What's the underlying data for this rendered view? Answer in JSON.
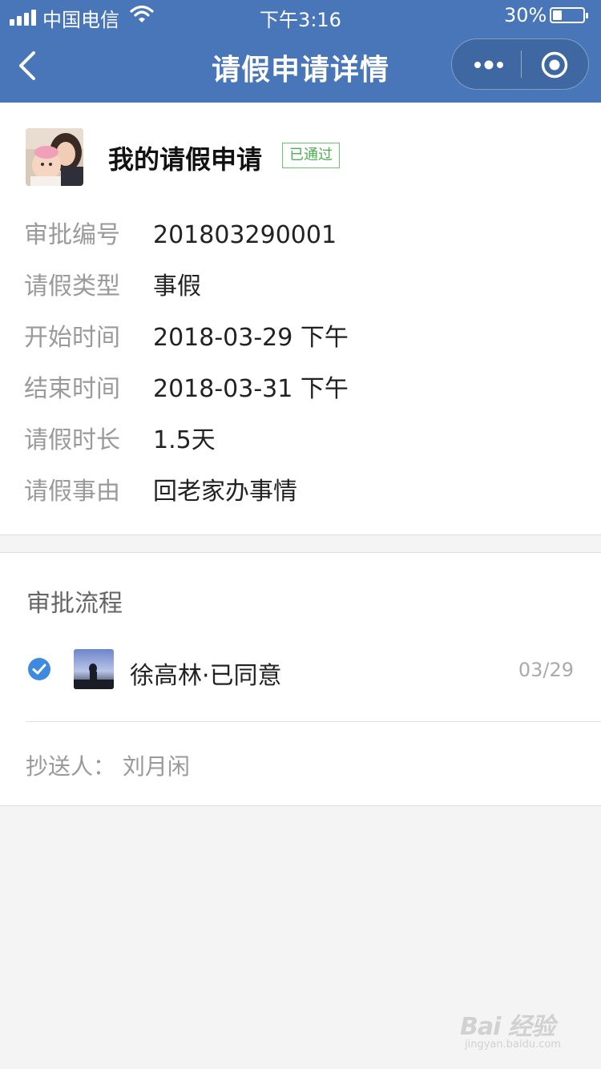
{
  "status_bar": {
    "carrier": "中国电信",
    "time": "下午3:16",
    "battery": "30%",
    "battery_level": 0.3
  },
  "nav": {
    "title": "请假申请详情",
    "back_icon": "back-chevron-icon",
    "more_icon": "more-dots-icon",
    "close_icon": "target-circle-icon",
    "bar_color": "#4876b8"
  },
  "application": {
    "title": "我的请假申请",
    "status_badge": "已通过",
    "status_color": "#4caf50",
    "fields": [
      {
        "label": "审批编号",
        "value": "201803290001"
      },
      {
        "label": "请假类型",
        "value": "事假"
      },
      {
        "label": "开始时间",
        "value": "2018-03-29 下午"
      },
      {
        "label": "结束时间",
        "value": "2018-03-31 下午"
      },
      {
        "label": "请假时长",
        "value": "1.5天"
      },
      {
        "label": "请假事由",
        "value": "回老家办事情"
      }
    ]
  },
  "approval": {
    "section_title": "审批流程",
    "steps": [
      {
        "approver": "徐高林·已同意",
        "date": "03/29",
        "check_color": "#3d8ae0"
      }
    ],
    "cc_line": "抄送人：  刘月闲"
  },
  "watermark": {
    "main": "Bai 经验",
    "sub": "jingyan.baidu.com"
  }
}
